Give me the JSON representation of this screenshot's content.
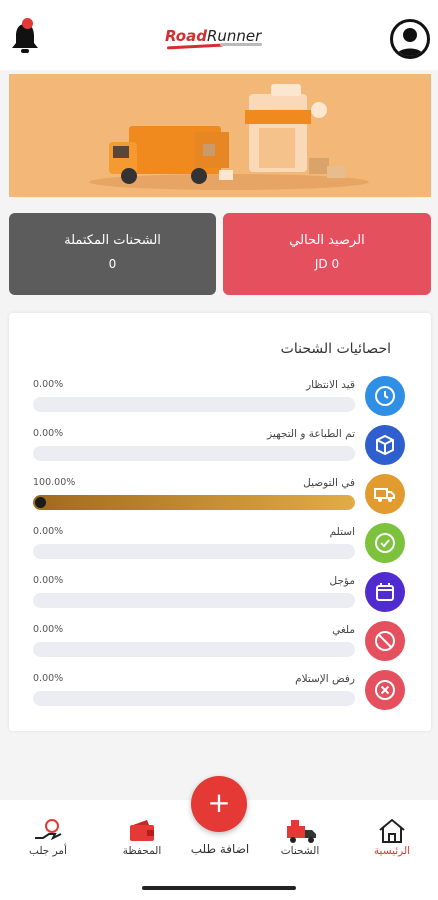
{
  "header": {
    "logo_road": "Road",
    "logo_runner": "Runner",
    "icons": [
      "bell-icon",
      "user-avatar-icon"
    ]
  },
  "cards": {
    "balance_title": "الرصيد الحالي",
    "balance_value": "JD 0",
    "completed_title": "الشحنات المكتملة",
    "completed_value": "0"
  },
  "stats": {
    "title": "احصائيات الشحنات",
    "rows": [
      {
        "label": "قيد الانتظار",
        "pct": "0.00%",
        "fill": 0,
        "color": "#2e8fe4",
        "icon": "clock-icon"
      },
      {
        "label": "تم الطباعة و التجهيز",
        "pct": "0.00%",
        "fill": 0,
        "color": "#2f5fcf",
        "icon": "box-icon"
      },
      {
        "label": "في التوصيل",
        "pct": "100.00%",
        "fill": 100,
        "color": "#e29b2f",
        "icon": "truck-icon"
      },
      {
        "label": "استلم",
        "pct": "0.00%",
        "fill": 0,
        "color": "#7cc23c",
        "icon": "check-circle-icon"
      },
      {
        "label": "مؤجل",
        "pct": "0.00%",
        "fill": 0,
        "color": "#4f2bd0",
        "icon": "calendar-icon"
      },
      {
        "label": "ملغي",
        "pct": "0.00%",
        "fill": 0,
        "color": "#e5505e",
        "icon": "ban-icon"
      },
      {
        "label": "رفض الإستلام",
        "pct": "0.00%",
        "fill": 0,
        "color": "#e5505e",
        "icon": "x-circle-icon"
      }
    ]
  },
  "nav": {
    "home": "الرئيسية",
    "shipments": "الشحنات",
    "add_order": "اضافة طلب",
    "wallet": "المحفظة",
    "pickup": "أمر جلب",
    "fab_symbol": "+"
  },
  "colors": {
    "accent": "#e53935",
    "banner": "#f3b877"
  }
}
